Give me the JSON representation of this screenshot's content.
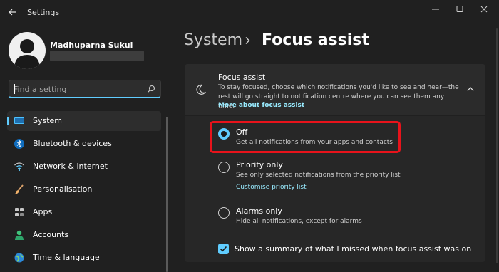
{
  "window": {
    "title": "Settings"
  },
  "user": {
    "name": "Madhuparna Sukul"
  },
  "search": {
    "placeholder": "Find a setting"
  },
  "sidebar": {
    "items": [
      {
        "label": "System",
        "icon": "system-icon",
        "active": true
      },
      {
        "label": "Bluetooth & devices",
        "icon": "bluetooth-icon"
      },
      {
        "label": "Network & internet",
        "icon": "wifi-icon"
      },
      {
        "label": "Personalisation",
        "icon": "brush-icon"
      },
      {
        "label": "Apps",
        "icon": "apps-icon"
      },
      {
        "label": "Accounts",
        "icon": "accounts-icon"
      },
      {
        "label": "Time & language",
        "icon": "time-language-icon"
      }
    ]
  },
  "breadcrumb": {
    "parent": "System",
    "separator": "›",
    "current": "Focus assist"
  },
  "focus_assist": {
    "title": "Focus assist",
    "description": "To stay focused, choose which notifications you'd like to see and hear—the rest will go straight to notification centre where you can see them any time.",
    "link": "More about focus assist",
    "options": [
      {
        "label": "Off",
        "description": "Get all notifications from your apps and contacts",
        "selected": true
      },
      {
        "label": "Priority only",
        "description": "See only selected notifications from the priority list",
        "link": "Customise priority list",
        "selected": false
      },
      {
        "label": "Alarms only",
        "description": "Hide all notifications, except for alarms",
        "selected": false
      }
    ],
    "summary_checkbox": {
      "label": "Show a summary of what I missed when focus assist was on",
      "checked": true
    }
  },
  "colors": {
    "accent": "#60cdff",
    "highlight": "#e8131b",
    "background": "#202020",
    "card": "#2b2b2b"
  }
}
